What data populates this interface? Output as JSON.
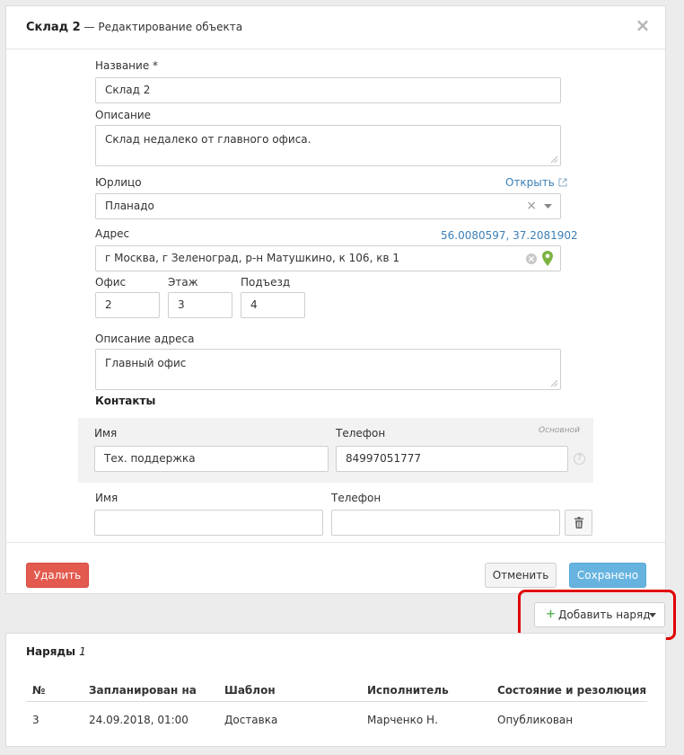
{
  "modal": {
    "title_strong": "Склад 2",
    "title_rest": " — Редактирование объекта",
    "close_icon": "close-icon"
  },
  "form": {
    "name": {
      "label": "Название *",
      "value": "Склад 2"
    },
    "description": {
      "label": "Описание",
      "value": "Склад недалеко от главного офиса."
    },
    "legal": {
      "label": "Юрлицо",
      "open_link": "Открыть",
      "value": "Планадо",
      "clear": "×"
    },
    "address": {
      "label": "Адрес",
      "coords": "56.0080597, 37.2081902",
      "value": "г Москва, г Зеленоград, р-н Матушкино, к 106, кв 1"
    },
    "office": {
      "label": "Офис",
      "value": "2"
    },
    "floor": {
      "label": "Этаж",
      "value": "3"
    },
    "entrance": {
      "label": "Подъезд",
      "value": "4"
    },
    "address_desc": {
      "label": "Описание адреса",
      "value": "Главный офис"
    }
  },
  "contacts": {
    "title": "Контакты",
    "primary": {
      "name_label": "Имя",
      "phone_label": "Телефон",
      "badge": "Основной",
      "name_value": "Тех. поддержка",
      "phone_value": "84997051777",
      "help": "?"
    },
    "new": {
      "name_label": "Имя",
      "phone_label": "Телефон",
      "name_value": "",
      "phone_value": ""
    }
  },
  "footer": {
    "delete": "Удалить",
    "cancel": "Отменить",
    "save": "Сохранено"
  },
  "add_order": {
    "label": "Добавить наряд",
    "icon": "plus-icon"
  },
  "orders": {
    "title": "Наряды",
    "count": "1",
    "columns": [
      "№",
      "Запланирован на",
      "Шаблон",
      "Исполнитель",
      "Состояние и резолюция"
    ],
    "rows": [
      {
        "id": "3",
        "date": "24.09.2018, 01:00",
        "template": "Доставка",
        "assignee": "Марченко Н.",
        "status": "Опубликован"
      }
    ]
  },
  "colors": {
    "danger": "#e35a4f",
    "primary": "#66b3e0",
    "link": "#3b7fb6",
    "highlight": "#e00000",
    "map_pin": "#7cb342",
    "plus": "#5cb85c"
  }
}
